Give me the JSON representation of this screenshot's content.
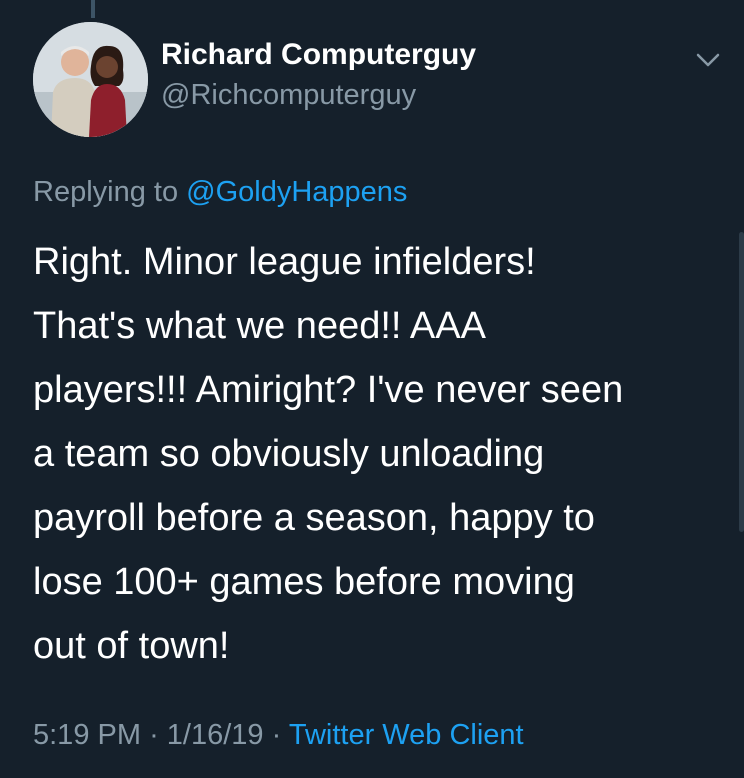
{
  "author": {
    "display_name": "Richard Computerguy",
    "handle": "@Richcomputerguy"
  },
  "reply": {
    "prefix": "Replying to",
    "mention": "@GoldyHappens"
  },
  "tweet": {
    "lines": [
      "Right. Minor league infielders!",
      "That's what we need!!  AAA",
      "players!!!  Amiright?  I've never seen",
      "a team so obviously unloading",
      "payroll before a season, happy to",
      "lose 100+ games before moving",
      "out of town!"
    ]
  },
  "meta": {
    "time": "5:19 PM",
    "separator": "·",
    "date": "1/16/19",
    "client": "Twitter Web Client"
  },
  "icons": {
    "caret": "chevron-down-icon"
  },
  "colors": {
    "background": "#15202b",
    "text": "#ffffff",
    "secondary": "#8899a6",
    "accent": "#1da1f2"
  }
}
